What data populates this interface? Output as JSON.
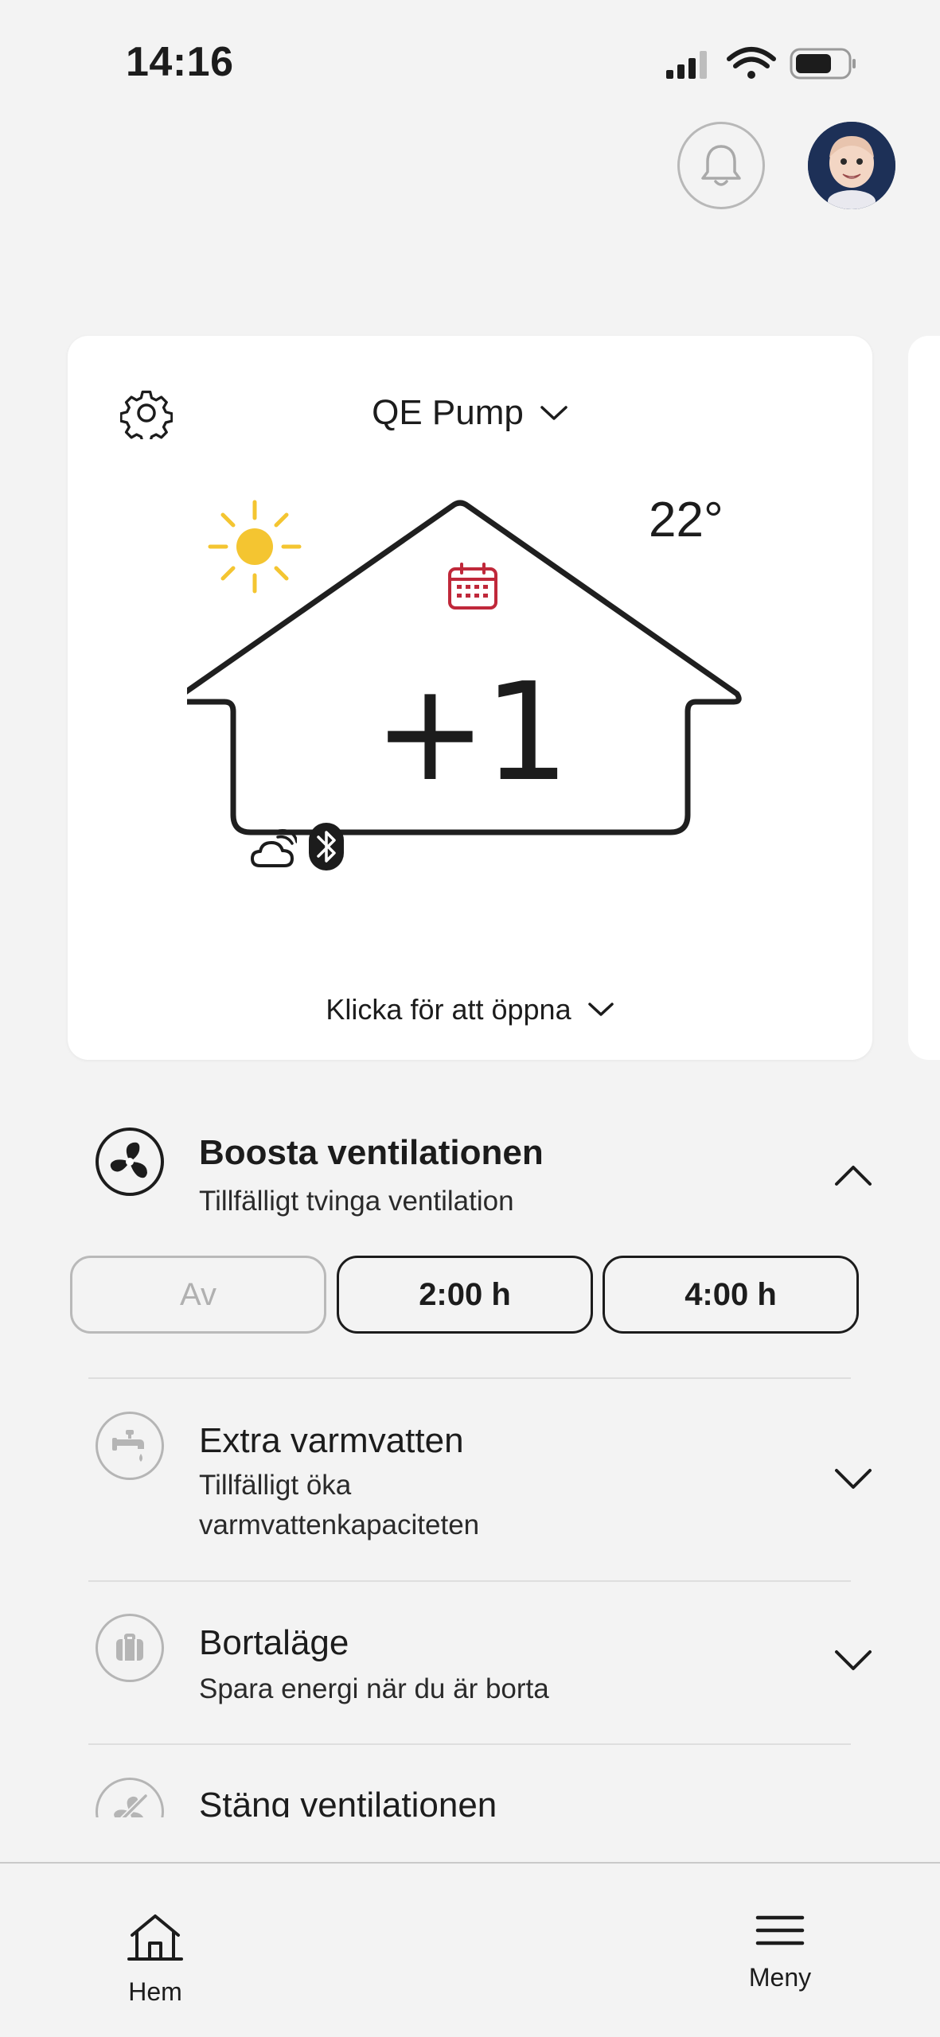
{
  "status_bar": {
    "time": "14:16"
  },
  "header": {
    "notifications_icon": "bell-icon",
    "avatar": "memoji-avatar"
  },
  "device_card": {
    "device_name": "QE Pump",
    "outdoor_temperature": "22°",
    "setpoint_offset": "+1",
    "weather_icon": "sun-icon",
    "schedule_icon": "calendar-icon",
    "status_icons": [
      "cloud-connected-icon",
      "bluetooth-icon"
    ],
    "open_label": "Klicka för att öppna",
    "accent_color": "#c0283a",
    "sun_color": "#f4c531"
  },
  "boost": {
    "title": "Boosta ventilationen",
    "subtitle": "Tillfälligt tvinga ventilation",
    "options": [
      "Av",
      "2:00 h",
      "4:00 h"
    ],
    "selected": "Av",
    "expanded": true
  },
  "hot_water": {
    "title": "Extra varmvatten",
    "subtitle_line1": "Tillfälligt öka",
    "subtitle_line2": "varmvattenkapaciteten"
  },
  "away": {
    "title": "Bortaläge",
    "subtitle": "Spara energi när du är borta"
  },
  "close_vent": {
    "title": "Stäng ventilationen"
  },
  "bottom_nav": {
    "home_label": "Hem",
    "menu_label": "Meny"
  }
}
